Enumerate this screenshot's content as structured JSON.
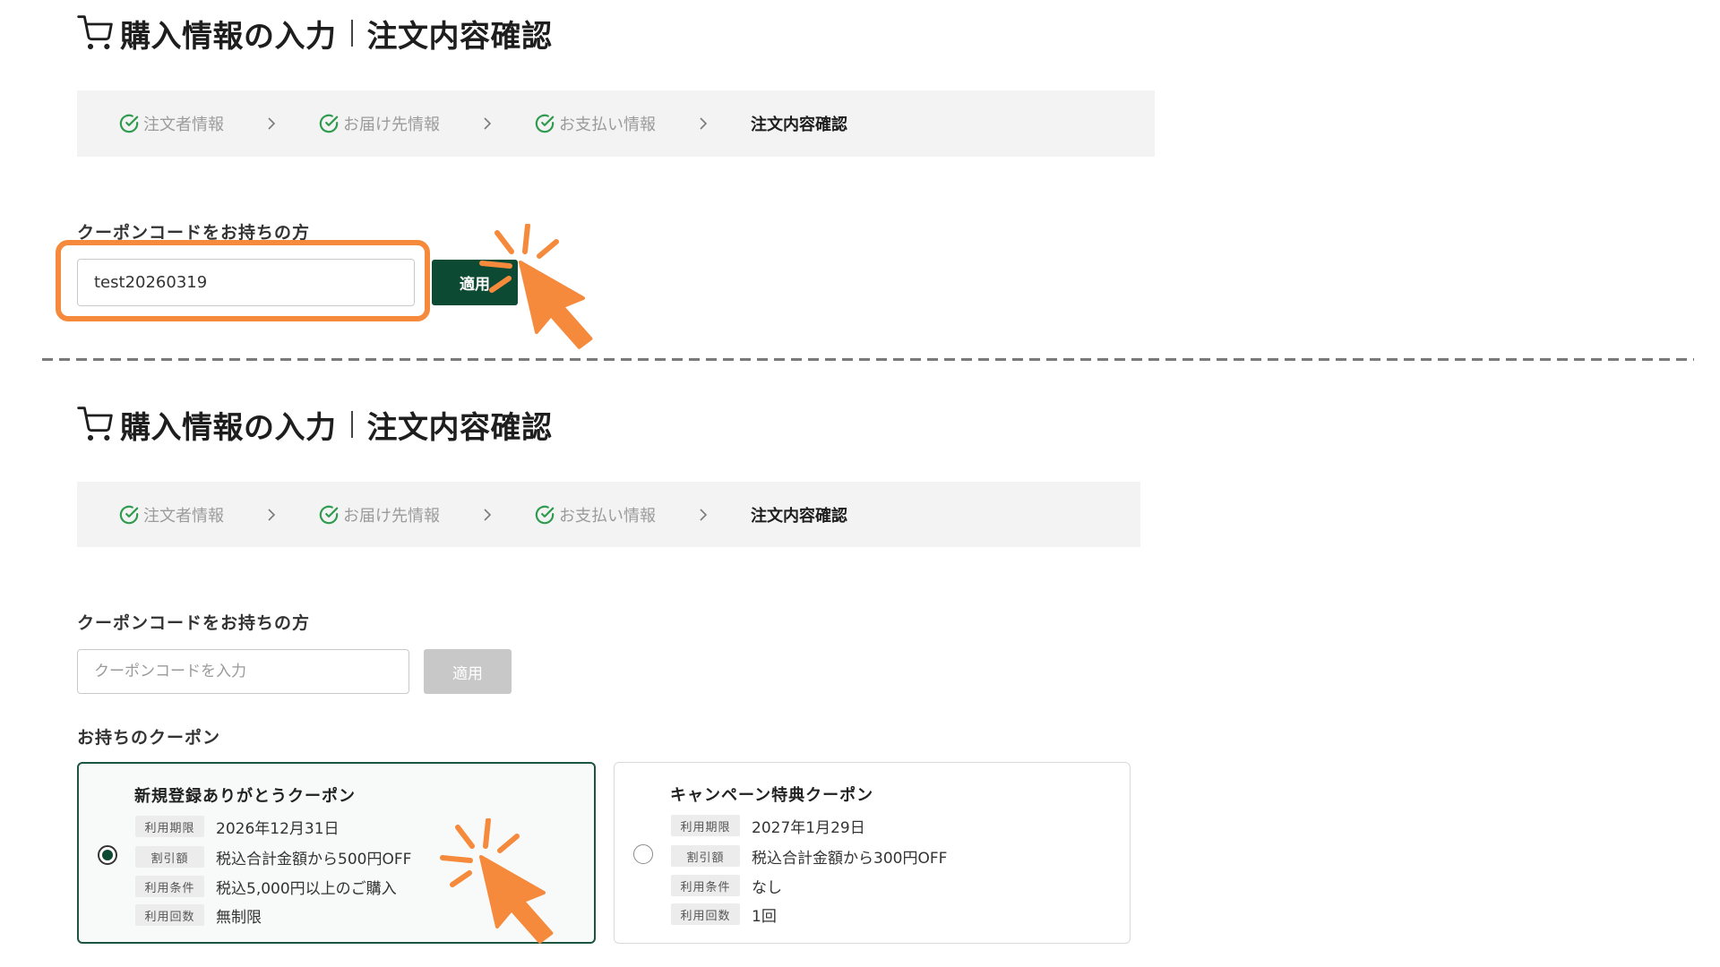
{
  "theme": {
    "accent": "#0c4a33",
    "check": "#2e9b4e",
    "highlight": "#f58a3c",
    "disabled": "#c8c8c8",
    "step_bar_bg": "#f3f3f3"
  },
  "annotation_icon": "click-pointer-icon",
  "top": {
    "header": {
      "icon": "cart-icon",
      "title_main": "購入情報の入力",
      "title_sub": "注文内容確認"
    },
    "separator_icon": "chevron-right-icon",
    "steps": [
      {
        "label": "注文者情報",
        "completed": true,
        "icon": "check-circle-icon"
      },
      {
        "label": "お届け先情報",
        "completed": true,
        "icon": "check-circle-icon"
      },
      {
        "label": "お支払い情報",
        "completed": true,
        "icon": "check-circle-icon"
      },
      {
        "label": "注文内容確認",
        "current": true
      }
    ],
    "coupon_form": {
      "label": "クーポンコードをお持ちの方",
      "value": "test20260319",
      "apply_label": "適用",
      "apply_enabled": true
    }
  },
  "bottom": {
    "header": {
      "icon": "cart-icon",
      "title_main": "購入情報の入力",
      "title_sub": "注文内容確認"
    },
    "separator_icon": "chevron-right-icon",
    "steps": [
      {
        "label": "注文者情報",
        "completed": true,
        "icon": "check-circle-icon"
      },
      {
        "label": "お届け先情報",
        "completed": true,
        "icon": "check-circle-icon"
      },
      {
        "label": "お支払い情報",
        "completed": true,
        "icon": "check-circle-icon"
      },
      {
        "label": "注文内容確認",
        "current": true
      }
    ],
    "coupon_form": {
      "label": "クーポンコードをお持ちの方",
      "placeholder": "クーポンコードを入力",
      "apply_label": "適用",
      "apply_enabled": false
    },
    "owned_coupons": {
      "label": "お持ちのクーポン",
      "items": [
        {
          "title": "新規登録ありがとうクーポン",
          "selected": true,
          "rows": [
            {
              "label": "利用期限",
              "value": "2026年12月31日"
            },
            {
              "label": "割引額",
              "value": "税込合計金額から500円OFF"
            },
            {
              "label": "利用条件",
              "value": "税込5,000円以上のご購入"
            },
            {
              "label": "利用回数",
              "value": "無制限"
            }
          ]
        },
        {
          "title": "キャンペーン特典クーポン",
          "selected": false,
          "rows": [
            {
              "label": "利用期限",
              "value": "2027年1月29日"
            },
            {
              "label": "割引額",
              "value": "税込合計金額から300円OFF"
            },
            {
              "label": "利用条件",
              "value": "なし"
            },
            {
              "label": "利用回数",
              "value": "1回"
            }
          ]
        }
      ]
    }
  }
}
